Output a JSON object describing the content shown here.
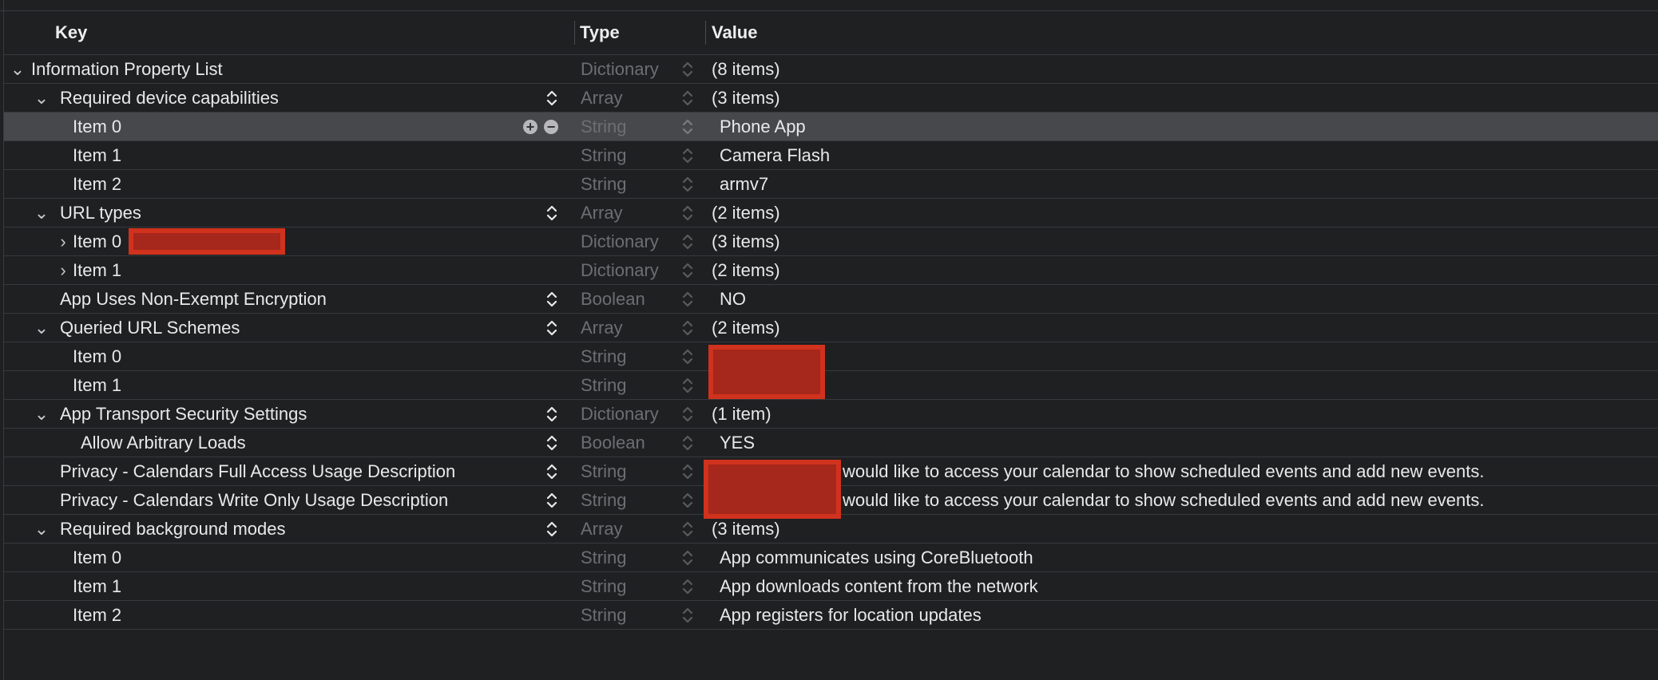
{
  "header": {
    "key": "Key",
    "type": "Type",
    "value": "Value"
  },
  "rows": [
    {
      "key": "Information Property List",
      "type": "Dictionary",
      "value": "(8 items)"
    },
    {
      "key": "Required device capabilities",
      "type": "Array",
      "value": "(3 items)"
    },
    {
      "key": "Item 0",
      "type": "String",
      "value": "Phone App"
    },
    {
      "key": "Item 1",
      "type": "String",
      "value": "Camera Flash"
    },
    {
      "key": "Item 2",
      "type": "String",
      "value": "armv7"
    },
    {
      "key": "URL types",
      "type": "Array",
      "value": "(2 items)"
    },
    {
      "key": "Item 0",
      "type": "Dictionary",
      "value": "(3 items)"
    },
    {
      "key": "Item 1",
      "type": "Dictionary",
      "value": "(2 items)"
    },
    {
      "key": "App Uses Non-Exempt Encryption",
      "type": "Boolean",
      "value": "NO"
    },
    {
      "key": "Queried URL Schemes",
      "type": "Array",
      "value": "(2 items)"
    },
    {
      "key": "Item 0",
      "type": "String",
      "value": ""
    },
    {
      "key": "Item 1",
      "type": "String",
      "value": ""
    },
    {
      "key": "App Transport Security Settings",
      "type": "Dictionary",
      "value": "(1 item)"
    },
    {
      "key": "Allow Arbitrary Loads",
      "type": "Boolean",
      "value": "YES"
    },
    {
      "key": "Privacy - Calendars Full Access Usage Description",
      "type": "String",
      "value": "would like to access your calendar to show scheduled events and add new events."
    },
    {
      "key": "Privacy - Calendars Write Only Usage Description",
      "type": "String",
      "value": "would like to access your calendar to show scheduled events and add new events."
    },
    {
      "key": "Required background modes",
      "type": "Array",
      "value": "(3 items)"
    },
    {
      "key": "Item 0",
      "type": "String",
      "value": "App communicates using CoreBluetooth"
    },
    {
      "key": "Item 1",
      "type": "String",
      "value": "App downloads content from the network"
    },
    {
      "key": "Item 2",
      "type": "String",
      "value": "App registers for location updates"
    }
  ],
  "colors": {
    "background": "#1f2022",
    "selected_row": "#47484c",
    "redaction": "#d0321d"
  }
}
